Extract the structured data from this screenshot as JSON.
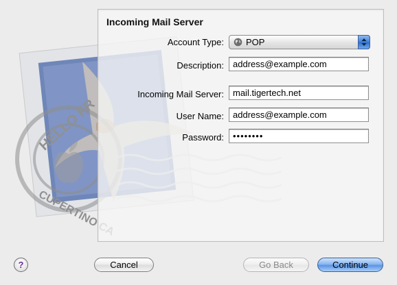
{
  "page": {
    "title": "Incoming Mail Server"
  },
  "stamp": {
    "postmark_top": "HELLO FR",
    "postmark_bottom": "CUPERTINO CA"
  },
  "form": {
    "account_type": {
      "label": "Account Type:",
      "value": "POP",
      "icon": "globe-icon"
    },
    "description": {
      "label": "Description:",
      "value": "address@example.com"
    },
    "incoming_server": {
      "label": "Incoming Mail Server:",
      "value": "mail.tigertech.net"
    },
    "user_name": {
      "label": "User Name:",
      "value": "address@example.com"
    },
    "password": {
      "label": "Password:",
      "value": "••••••••"
    }
  },
  "buttons": {
    "help": "?",
    "cancel": "Cancel",
    "go_back": "Go Back",
    "continue": "Continue"
  },
  "colors": {
    "default_button": "#5a95e6",
    "help_glyph": "#6a2ca0"
  }
}
